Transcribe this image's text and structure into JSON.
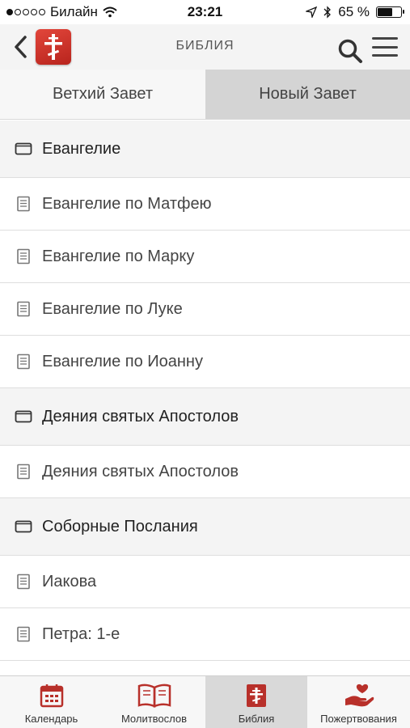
{
  "status_bar": {
    "carrier": "Билайн",
    "time": "23:21",
    "battery_percent": "65 %",
    "battery_level": 0.65,
    "signal_bars_filled": 1,
    "signal_bars_total": 5
  },
  "header": {
    "title": "БИБЛИЯ",
    "icons": {
      "back": "chevron-left-icon",
      "logo": "orthodox-cross-logo",
      "search": "search-icon",
      "menu": "hamburger-menu-icon"
    }
  },
  "tabs": [
    {
      "label": "Ветхий Завет",
      "selected": false
    },
    {
      "label": "Новый Завет",
      "selected": true
    }
  ],
  "list": {
    "sections": [
      {
        "title": "Евангелие",
        "books": [
          "Евангелие по Матфею",
          "Евангелие по Марку",
          "Евангелие по Луке",
          "Евангелие по Иоанну"
        ]
      },
      {
        "title": "Деяния святых Апостолов",
        "books": [
          "Деяния святых Апостолов"
        ]
      },
      {
        "title": "Соборные Послания",
        "books": [
          "Иакова",
          "Петра: 1-е"
        ]
      }
    ]
  },
  "tab_bar": {
    "items": [
      {
        "label": "Календарь",
        "icon": "calendar-icon",
        "active": false
      },
      {
        "label": "Молитвослов",
        "icon": "prayer-book-icon",
        "active": false
      },
      {
        "label": "Библия",
        "icon": "bible-icon",
        "active": true
      },
      {
        "label": "Пожертвования",
        "icon": "donation-hand-heart-icon",
        "active": false
      }
    ]
  },
  "colors": {
    "accent": "#c8322a",
    "nav_background": "#f4f4f4",
    "selected_tab": "#d4d4d4",
    "section_background": "#f4f4f4"
  }
}
